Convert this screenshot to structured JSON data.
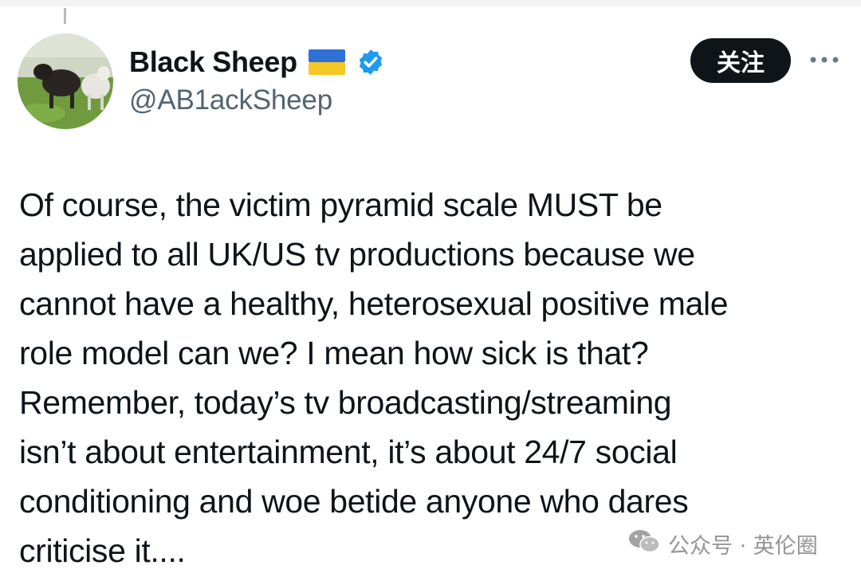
{
  "profile": {
    "display_name": "Black Sheep",
    "handle": "@AB1ackSheep",
    "flag_icon": "ukraine-flag-icon",
    "verified_icon": "verified-badge-icon",
    "verified_color": "#1d9bf0"
  },
  "actions": {
    "follow_label": "关注",
    "more_icon": "more-horizontal-icon"
  },
  "tweet": {
    "text": "Of course, the victim pyramid scale MUST be\napplied to all UK/US tv productions because we\ncannot have a healthy, heterosexual positive male\nrole model can we? I mean how sick is that?\nRemember, today’s tv broadcasting/streaming\nisn’t about entertainment, it’s about 24/7 social\nconditioning and woe betide anyone who dares\ncriticise it...."
  },
  "watermark": {
    "text": "公众号 · 英伦圈",
    "icon": "wechat-icon"
  }
}
